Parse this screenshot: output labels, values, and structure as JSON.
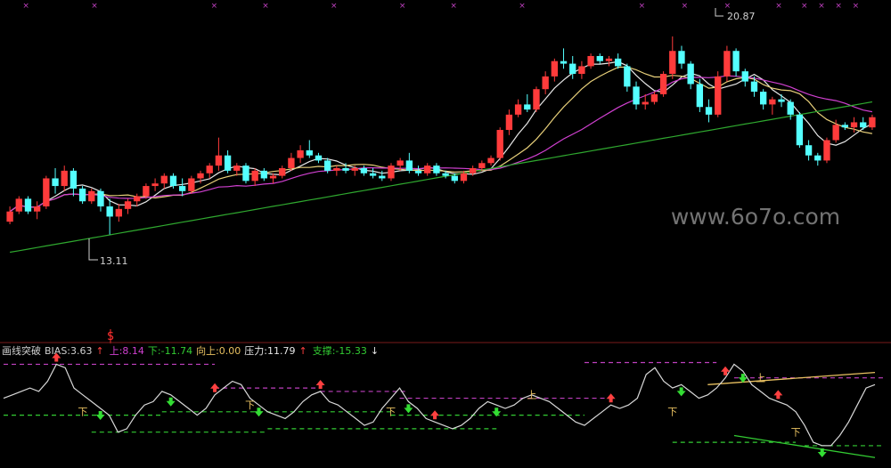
{
  "chart_data": [
    {
      "type": "candlestick",
      "panel": "price",
      "annotations": {
        "high_label": "20.87",
        "low_label": "13.11"
      },
      "watermark": "www.6o7o.com",
      "marker_glyph": "×",
      "sell_marker": "S",
      "candles": [
        [
          13.6,
          14.2,
          13.5,
          14.0
        ],
        [
          14.0,
          14.6,
          13.9,
          14.5
        ],
        [
          14.5,
          14.6,
          13.9,
          14.0
        ],
        [
          14.0,
          14.4,
          13.7,
          14.2
        ],
        [
          14.2,
          15.4,
          14.1,
          15.3
        ],
        [
          15.3,
          15.7,
          14.7,
          15.0
        ],
        [
          15.0,
          15.8,
          14.8,
          15.6
        ],
        [
          15.6,
          15.7,
          14.6,
          14.9
        ],
        [
          14.9,
          15.0,
          14.3,
          14.4
        ],
        [
          14.4,
          14.9,
          14.3,
          14.8
        ],
        [
          14.8,
          14.9,
          14.0,
          14.2
        ],
        [
          14.2,
          14.5,
          13.1,
          13.8
        ],
        [
          13.8,
          14.3,
          13.6,
          14.1
        ],
        [
          14.1,
          14.5,
          13.9,
          14.4
        ],
        [
          14.4,
          14.7,
          14.2,
          14.6
        ],
        [
          14.6,
          15.1,
          14.5,
          15.0
        ],
        [
          15.0,
          15.3,
          14.8,
          15.1
        ],
        [
          15.1,
          15.5,
          14.9,
          15.4
        ],
        [
          15.4,
          15.5,
          14.9,
          15.0
        ],
        [
          15.0,
          15.3,
          14.6,
          14.8
        ],
        [
          14.8,
          15.4,
          14.7,
          15.3
        ],
        [
          15.3,
          15.6,
          15.1,
          15.5
        ],
        [
          15.5,
          15.9,
          15.3,
          15.8
        ],
        [
          15.8,
          16.9,
          15.6,
          16.2
        ],
        [
          16.2,
          16.4,
          15.5,
          15.6
        ],
        [
          15.6,
          15.9,
          15.4,
          15.8
        ],
        [
          15.8,
          15.9,
          15.1,
          15.2
        ],
        [
          15.2,
          15.7,
          15.0,
          15.6
        ],
        [
          15.6,
          15.7,
          15.2,
          15.3
        ],
        [
          15.3,
          15.5,
          15.1,
          15.4
        ],
        [
          15.4,
          15.8,
          15.3,
          15.7
        ],
        [
          15.7,
          16.3,
          15.6,
          16.1
        ],
        [
          16.1,
          16.6,
          15.9,
          16.4
        ],
        [
          16.4,
          16.8,
          16.1,
          16.2
        ],
        [
          16.2,
          16.3,
          15.9,
          16.0
        ],
        [
          16.0,
          16.1,
          15.5,
          15.6
        ],
        [
          15.6,
          15.8,
          15.4,
          15.7
        ],
        [
          15.7,
          15.9,
          15.5,
          15.6
        ],
        [
          15.6,
          15.8,
          15.4,
          15.7
        ],
        [
          15.7,
          15.8,
          15.4,
          15.5
        ],
        [
          15.5,
          15.7,
          15.3,
          15.4
        ],
        [
          15.4,
          15.6,
          15.2,
          15.3
        ],
        [
          15.3,
          15.9,
          15.2,
          15.8
        ],
        [
          15.8,
          16.1,
          15.6,
          16.0
        ],
        [
          16.0,
          16.3,
          15.5,
          15.6
        ],
        [
          15.6,
          15.8,
          15.4,
          15.5
        ],
        [
          15.5,
          15.9,
          15.4,
          15.8
        ],
        [
          15.8,
          15.9,
          15.4,
          15.5
        ],
        [
          15.5,
          15.6,
          15.3,
          15.4
        ],
        [
          15.4,
          15.5,
          15.1,
          15.2
        ],
        [
          15.2,
          15.6,
          15.1,
          15.5
        ],
        [
          15.5,
          15.8,
          15.4,
          15.7
        ],
        [
          15.7,
          16.0,
          15.6,
          15.9
        ],
        [
          15.9,
          16.2,
          15.8,
          16.1
        ],
        [
          16.1,
          17.3,
          16.0,
          17.2
        ],
        [
          17.2,
          18.0,
          17.0,
          17.8
        ],
        [
          17.8,
          18.4,
          17.7,
          18.2
        ],
        [
          18.2,
          18.6,
          17.9,
          18.0
        ],
        [
          18.0,
          18.9,
          17.9,
          18.8
        ],
        [
          18.8,
          19.5,
          18.6,
          19.3
        ],
        [
          19.3,
          20.0,
          19.1,
          19.9
        ],
        [
          19.9,
          20.4,
          19.6,
          19.8
        ],
        [
          19.8,
          20.1,
          19.2,
          19.4
        ],
        [
          19.4,
          19.9,
          19.2,
          19.7
        ],
        [
          19.7,
          20.2,
          19.6,
          20.1
        ],
        [
          20.1,
          20.2,
          19.8,
          19.9
        ],
        [
          19.9,
          20.1,
          19.7,
          20.0
        ],
        [
          20.0,
          20.2,
          19.6,
          19.7
        ],
        [
          19.7,
          19.8,
          18.7,
          18.9
        ],
        [
          18.9,
          19.1,
          18.0,
          18.2
        ],
        [
          18.2,
          18.6,
          18.0,
          18.3
        ],
        [
          18.3,
          18.7,
          18.2,
          18.6
        ],
        [
          18.6,
          19.5,
          18.5,
          19.4
        ],
        [
          19.4,
          20.87,
          19.2,
          20.3
        ],
        [
          20.3,
          20.5,
          19.6,
          19.8
        ],
        [
          19.8,
          19.9,
          18.8,
          19.0
        ],
        [
          19.0,
          19.2,
          17.9,
          18.1
        ],
        [
          18.1,
          18.4,
          17.5,
          17.8
        ],
        [
          17.8,
          19.5,
          17.7,
          19.3
        ],
        [
          19.3,
          20.5,
          19.1,
          20.3
        ],
        [
          20.3,
          20.4,
          19.3,
          19.5
        ],
        [
          19.5,
          19.6,
          18.9,
          19.1
        ],
        [
          19.1,
          19.3,
          18.5,
          18.7
        ],
        [
          18.7,
          18.8,
          18.0,
          18.2
        ],
        [
          18.2,
          18.5,
          17.8,
          18.4
        ],
        [
          18.4,
          18.6,
          18.1,
          18.3
        ],
        [
          18.3,
          18.4,
          17.6,
          17.8
        ],
        [
          17.8,
          17.9,
          16.5,
          16.6
        ],
        [
          16.6,
          16.8,
          16.0,
          16.2
        ],
        [
          16.2,
          16.3,
          15.8,
          16.0
        ],
        [
          16.0,
          16.9,
          15.9,
          16.8
        ],
        [
          16.8,
          17.6,
          16.7,
          17.4
        ],
        [
          17.4,
          17.5,
          17.2,
          17.3
        ],
        [
          17.3,
          17.7,
          17.1,
          17.5
        ],
        [
          17.5,
          17.7,
          17.2,
          17.3
        ],
        [
          17.3,
          17.8,
          17.2,
          17.7
        ]
      ],
      "ma": [
        {
          "name": "MA5",
          "color": "#e6e6e6"
        },
        {
          "name": "MA10",
          "color": "#e8d07a"
        },
        {
          "name": "MA20",
          "color": "#d040d0"
        },
        {
          "name": "MA60",
          "color": "#2fa82f"
        }
      ]
    },
    {
      "type": "line",
      "panel": "indicator",
      "legend": [
        {
          "text": "画线突破",
          "color": "#cfcfcf"
        },
        {
          "text": "BIAS:3.63",
          "color": "#cfcfcf"
        },
        {
          "text": "↑",
          "color": "#ff4040"
        },
        {
          "text": "上:8.14",
          "color": "#d040d0"
        },
        {
          "text": "下:-11.74",
          "color": "#33cc33"
        },
        {
          "text": "向上:0.00",
          "color": "#e8c060"
        },
        {
          "text": "压力:11.79",
          "color": "#e6e6e6"
        },
        {
          "text": "↑",
          "color": "#ff4040"
        },
        {
          "text": "支撑:-15.33",
          "color": "#33cc33"
        },
        {
          "text": "↓",
          "color": "#e6e6e6"
        }
      ],
      "labels": {
        "down": "下",
        "up": "上"
      },
      "values": [
        -1,
        0,
        1,
        2,
        1,
        4,
        9,
        8,
        2,
        0,
        -2,
        -4,
        -6,
        -11,
        -10,
        -6,
        -3,
        -2,
        1,
        0,
        -2,
        -4,
        -6,
        -4,
        0,
        2,
        4,
        3,
        -1,
        -3,
        -5,
        -6,
        -7,
        -5,
        -2,
        0,
        1,
        -2,
        -3,
        -5,
        -7,
        -9,
        -8,
        -4,
        -1,
        2,
        -2,
        -4,
        -7,
        -8,
        -9,
        -10,
        -9,
        -7,
        -4,
        -2,
        -3,
        -4,
        -3,
        -1,
        0,
        -1,
        -2,
        -4,
        -6,
        -8,
        -9,
        -7,
        -5,
        -3,
        -4,
        -3,
        -1,
        6,
        8,
        4,
        2,
        3,
        1,
        -1,
        0,
        2,
        5,
        9,
        7,
        3,
        1,
        -1,
        -2,
        -3,
        -5,
        -9,
        -14,
        -15,
        -15,
        -12,
        -8,
        -3,
        2,
        3
      ],
      "ylim": [
        -20,
        12
      ]
    }
  ]
}
